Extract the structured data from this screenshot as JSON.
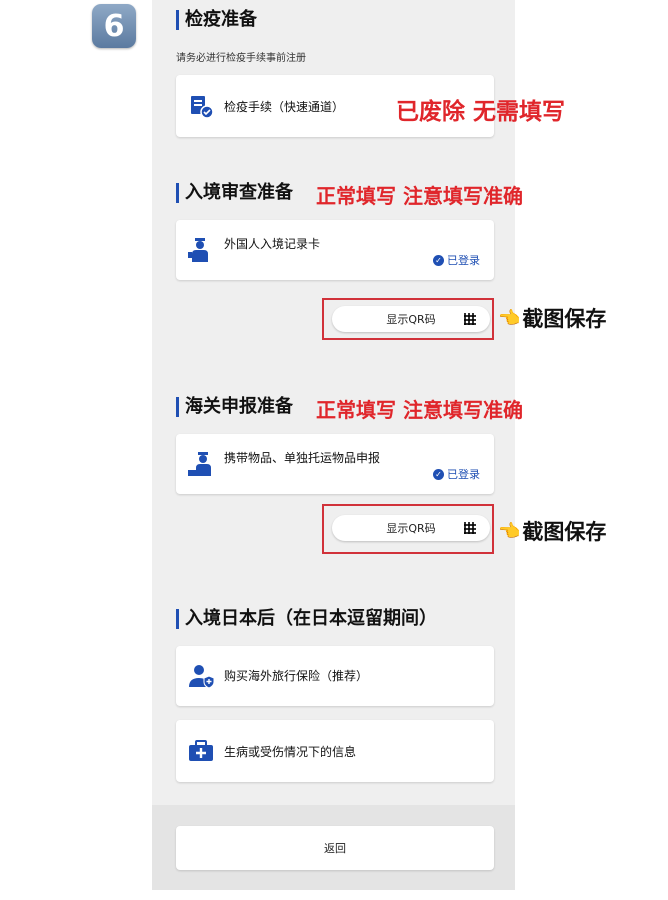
{
  "step_number": "6",
  "quarantine": {
    "title": "检疫准备",
    "subtitle": "请务必进行检疫手续事前注册",
    "card_label": "检疫手续（快速通道）",
    "note": "已废除 无需填写"
  },
  "immigration": {
    "title": "入境审查准备",
    "note": "正常填写 注意填写准确",
    "card_label": "外国人入境记录卡",
    "status": "已登录",
    "qr_label": "显示QR码",
    "save_note": "截图保存"
  },
  "customs": {
    "title": "海关申报准备",
    "note": "正常填写 注意填写准确",
    "card_label": "携带物品、单独托运物品申报",
    "status": "已登录",
    "qr_label": "显示QR码",
    "save_note": "截图保存"
  },
  "after_entry": {
    "title": "入境日本后（在日本逗留期间）",
    "insurance_label": "购买海外旅行保险（推荐）",
    "illness_label": "生病或受伤情况下的信息"
  },
  "back_label": "返回",
  "colors": {
    "accent": "#1f4fb3",
    "note_red": "#e0262b",
    "highlight_border": "#d1323a"
  }
}
